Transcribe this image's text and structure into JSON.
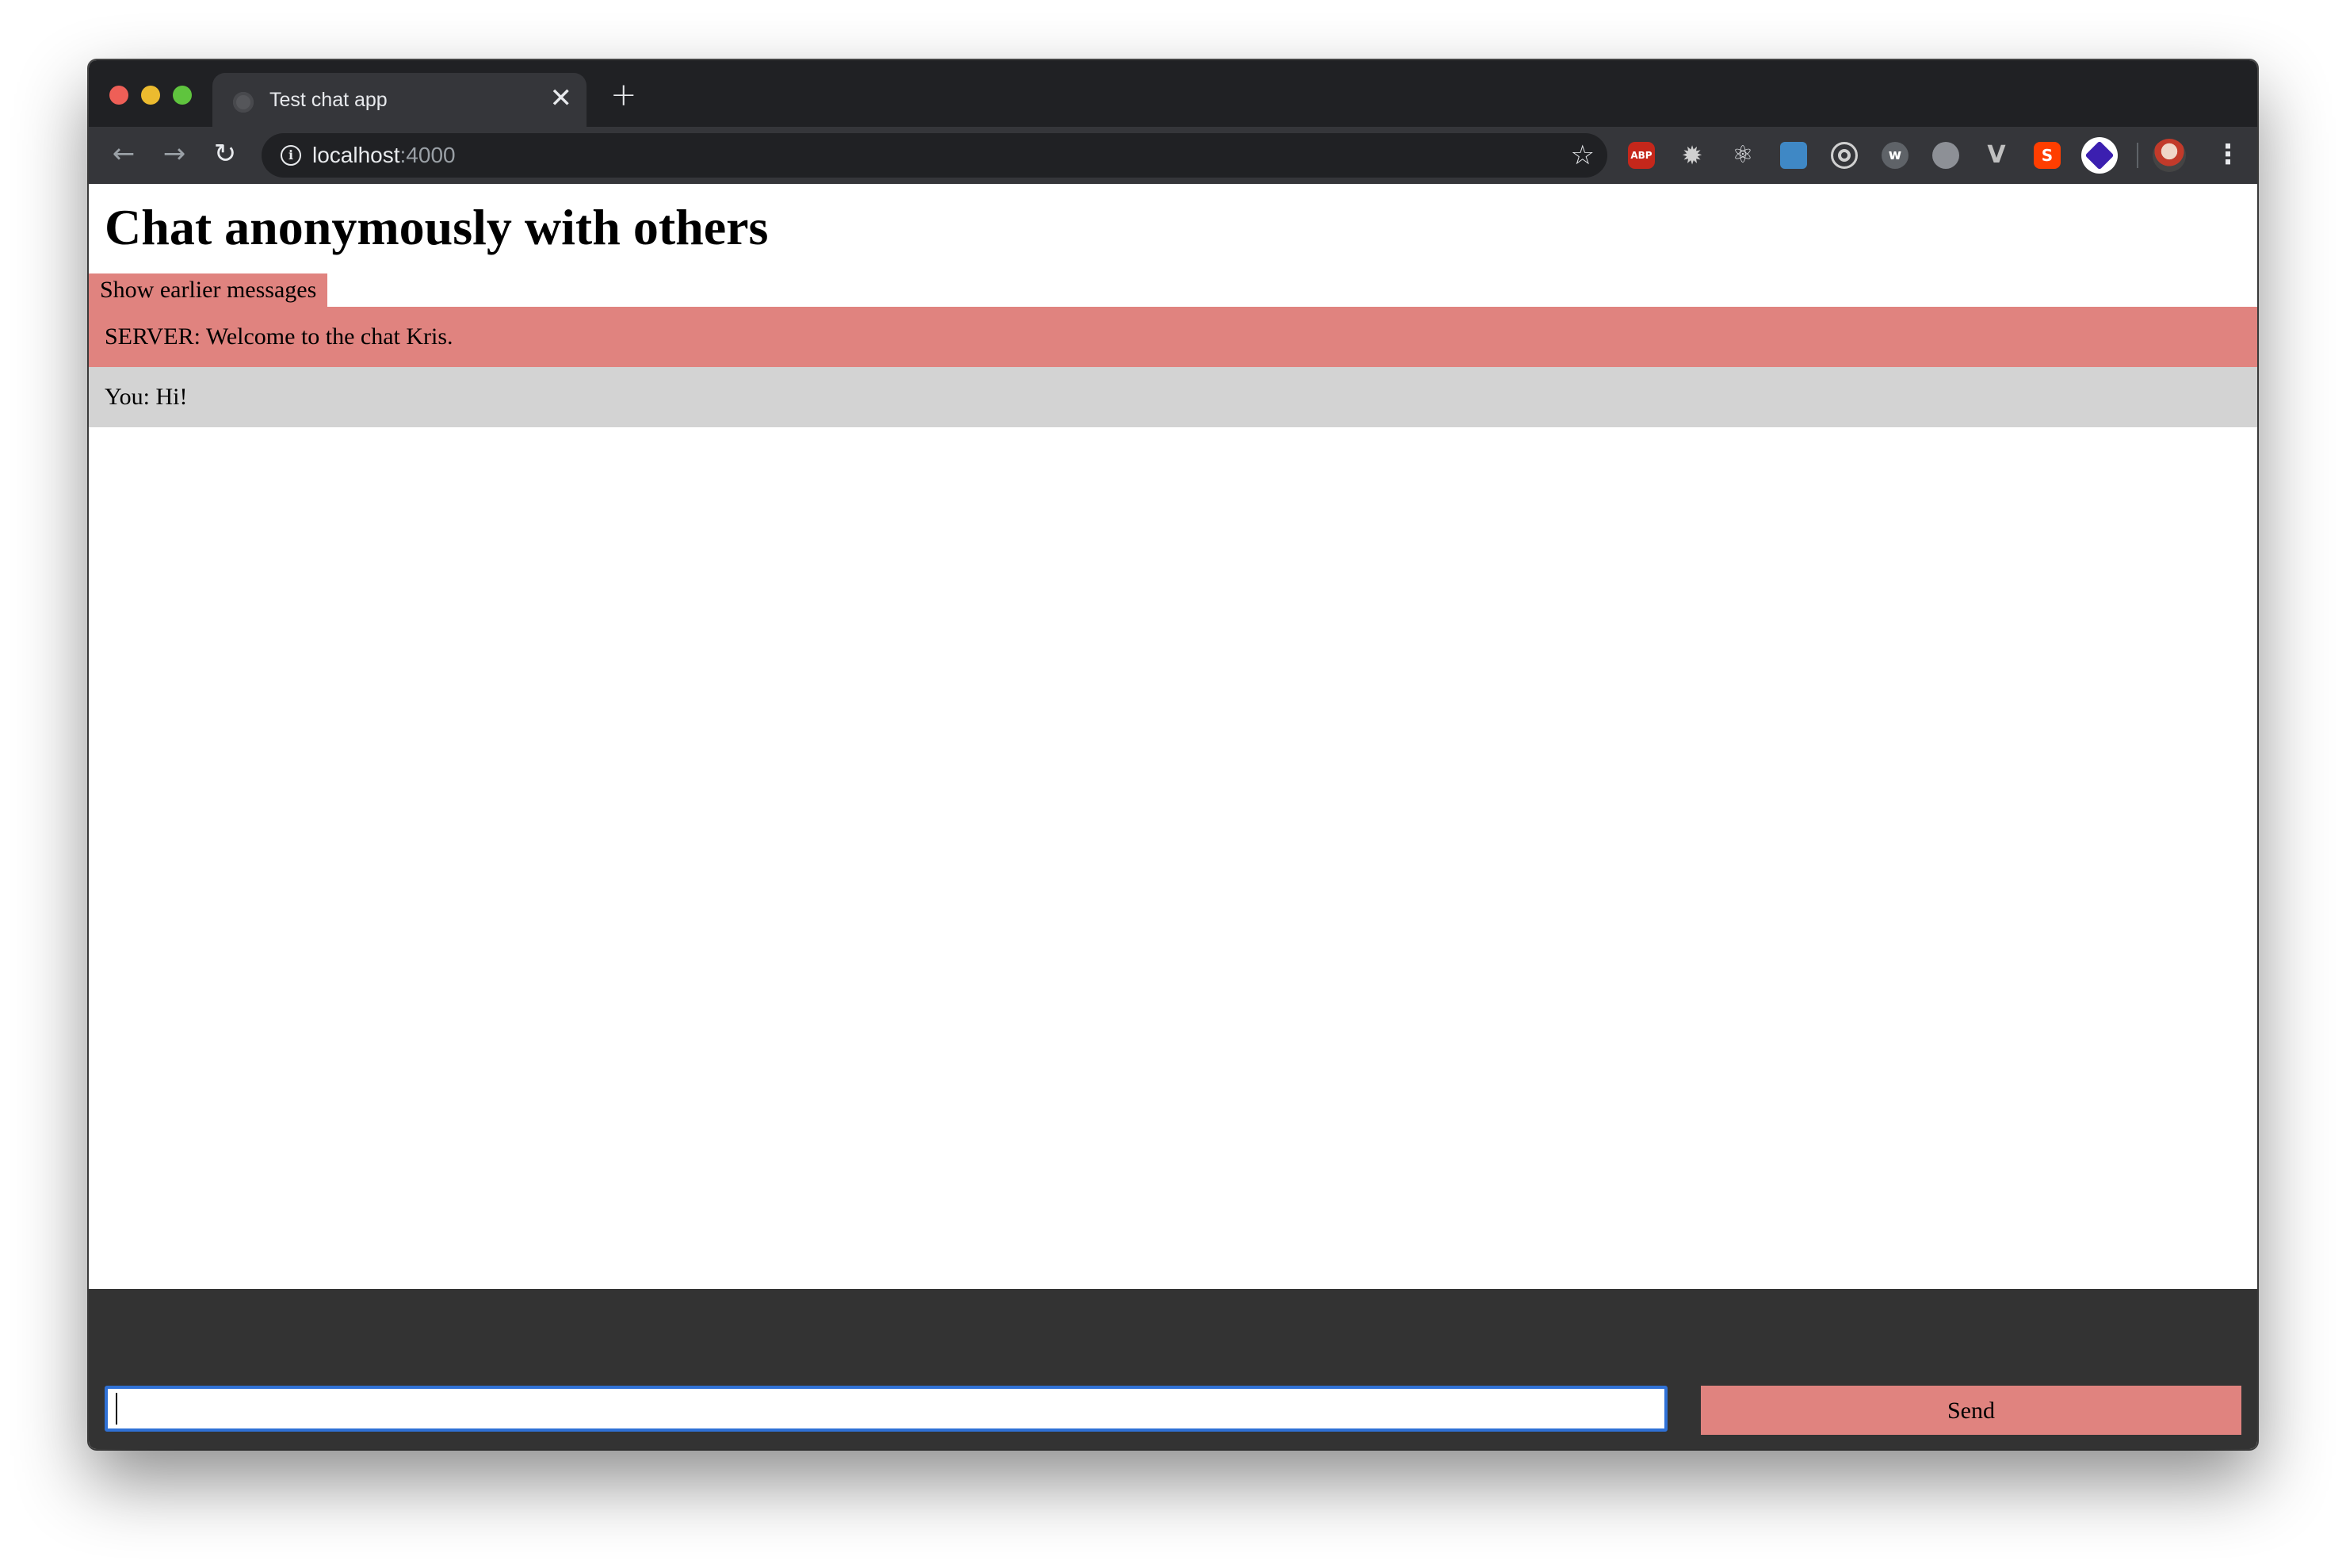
{
  "browser": {
    "tab": {
      "title": "Test chat app",
      "close_glyph": "✕"
    },
    "new_tab_glyph": "+",
    "nav": {
      "back_glyph": "←",
      "forward_glyph": "→",
      "reload_glyph": "↻"
    },
    "address": {
      "host": "localhost",
      "port": ":4000"
    },
    "bookmark_glyph": "☆",
    "extensions": [
      {
        "name": "adblock-plus-icon",
        "label": "ABP"
      },
      {
        "name": "gear-extension-icon",
        "label": "✹"
      },
      {
        "name": "react-devtools-icon",
        "label": "⚛"
      },
      {
        "name": "document-extension-icon",
        "label": ""
      },
      {
        "name": "target-extension-icon",
        "label": ""
      },
      {
        "name": "w-extension-icon",
        "label": "w"
      },
      {
        "name": "globe-extension-icon",
        "label": ""
      },
      {
        "name": "vue-devtools-icon",
        "label": "V"
      },
      {
        "name": "svelte-devtools-icon",
        "label": "S"
      },
      {
        "name": "layers-extension-icon",
        "label": ""
      }
    ],
    "menu_glyph": "⋮"
  },
  "page": {
    "title": "Chat anonymously with others",
    "show_earlier_label": "Show earlier messages",
    "messages": [
      {
        "type": "server",
        "text": "SERVER: Welcome to the chat Kris."
      },
      {
        "type": "self",
        "text": "You: Hi!"
      }
    ],
    "composer": {
      "input_value": "",
      "send_label": "Send"
    }
  },
  "colors": {
    "accent": "#e0837f",
    "self_message_bg": "#d3d3d3",
    "composer_bg": "#333333",
    "focus_ring": "#2f71d6"
  }
}
